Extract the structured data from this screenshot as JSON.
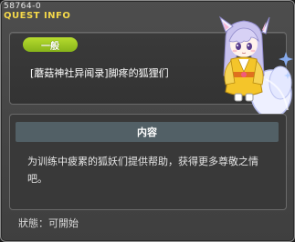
{
  "quest": {
    "id": "58764-0",
    "title": "QUEST INFO",
    "category": "一般",
    "name": "[蘑菇神社异闻录]脚疼的狐狸们"
  },
  "content": {
    "header": "内容",
    "description": "为训练中疲累的狐妖们提供帮助，获得更多尊敬之情吧。"
  },
  "status": {
    "text": "狀態：可開始"
  },
  "colors": {
    "title": "#f4d84a",
    "category_pill": "#9bc823",
    "content_header": "#526066"
  },
  "icons": {
    "portrait": "fox-girl-portrait"
  }
}
